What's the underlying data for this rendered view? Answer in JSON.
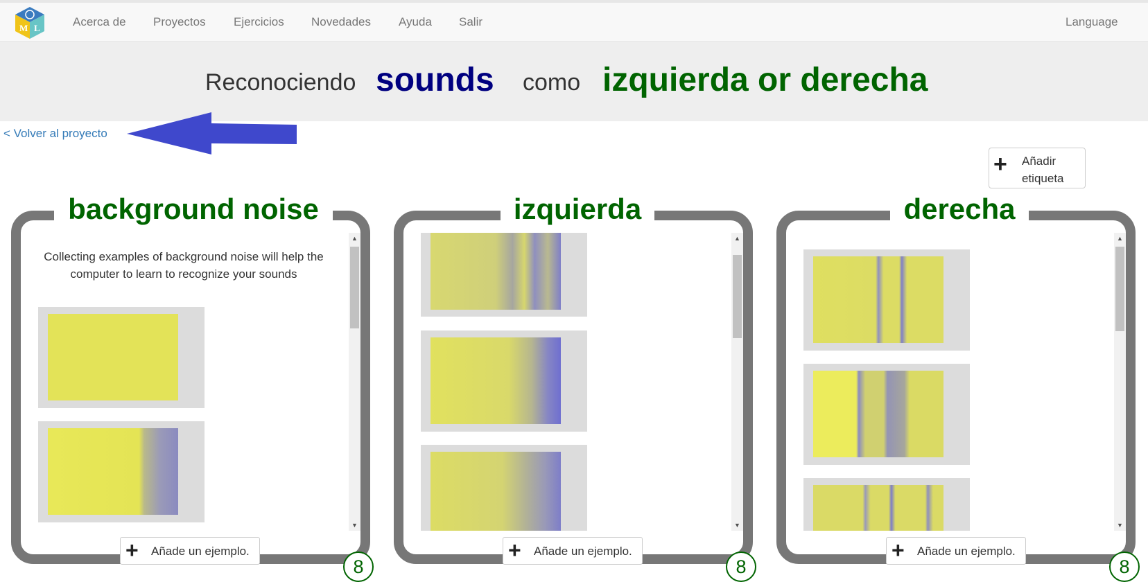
{
  "nav": {
    "logo_letters": [
      "M",
      "L"
    ],
    "items": [
      "Acerca de",
      "Proyectos",
      "Ejercicios",
      "Novedades",
      "Ayuda",
      "Salir"
    ],
    "language": "Language"
  },
  "header": {
    "prefix": "Reconociendo",
    "type": "sounds",
    "middle": "como",
    "labels": "izquierda or derecha"
  },
  "back_link": "< Volver al proyecto",
  "add_label": {
    "line1": "Añadir",
    "line2": "etiqueta"
  },
  "buckets": [
    {
      "title": "background noise",
      "hint": "Collecting examples of background noise will help the computer to learn to recognize your sounds",
      "add_example": "Añade un ejemplo.",
      "count": "8"
    },
    {
      "title": "izquierda",
      "hint": "",
      "add_example": "Añade un ejemplo.",
      "count": "8"
    },
    {
      "title": "derecha",
      "hint": "",
      "add_example": "Añade un ejemplo.",
      "count": "8"
    }
  ],
  "colors": {
    "title_green": "#006400",
    "type_navy": "#000080",
    "link_blue": "#337ab7",
    "arrow_blue": "#3f48cc",
    "spectrogram_yellow": "#e3e358",
    "spectrogram_blue": "#4a4ad6",
    "bucket_border": "#777777"
  },
  "icons": {
    "logo": "ml-cube-logo",
    "add": "plus-icon",
    "scroll_up": "triangle-up-icon",
    "scroll_down": "triangle-down-icon",
    "arrow": "left-arrow-annotation"
  }
}
